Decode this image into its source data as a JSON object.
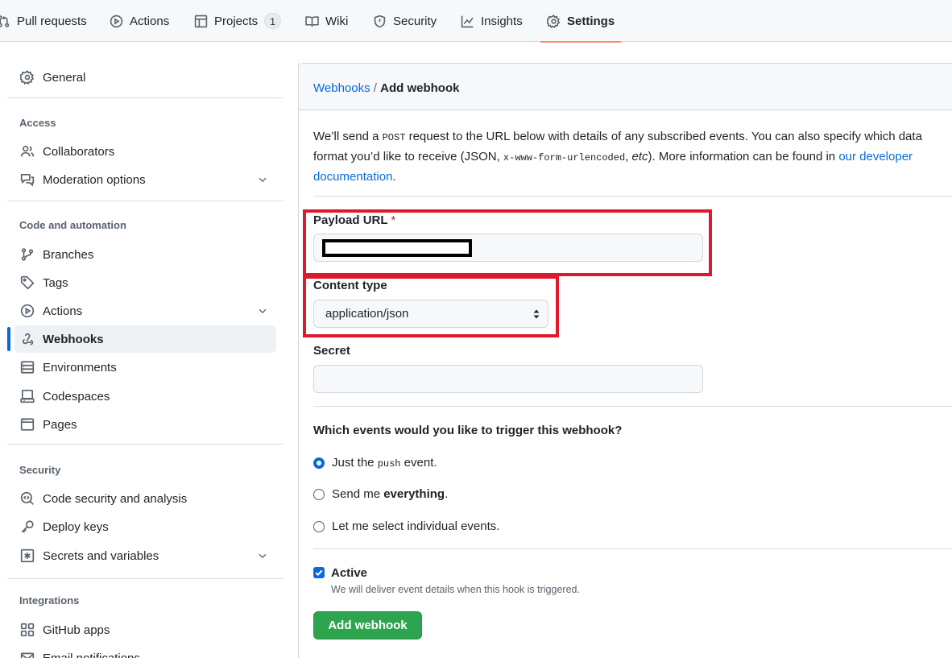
{
  "repo_nav": {
    "tabs": [
      {
        "label": "Pull requests",
        "icon": "pull-request-icon"
      },
      {
        "label": "Actions",
        "icon": "play-circle-icon"
      },
      {
        "label": "Projects",
        "icon": "table-icon",
        "count": "1"
      },
      {
        "label": "Wiki",
        "icon": "book-icon"
      },
      {
        "label": "Security",
        "icon": "shield-icon"
      },
      {
        "label": "Insights",
        "icon": "graph-icon"
      },
      {
        "label": "Settings",
        "icon": "gear-icon",
        "active": true
      }
    ]
  },
  "sidebar": {
    "general": "General",
    "access_heading": "Access",
    "collaborators": "Collaborators",
    "moderation": "Moderation options",
    "code_heading": "Code and automation",
    "branches": "Branches",
    "tags": "Tags",
    "actions": "Actions",
    "webhooks": "Webhooks",
    "environments": "Environments",
    "codespaces": "Codespaces",
    "pages": "Pages",
    "security_heading": "Security",
    "code_security": "Code security and analysis",
    "deploy_keys": "Deploy keys",
    "secrets": "Secrets and variables",
    "integrations_heading": "Integrations",
    "github_apps": "GitHub apps",
    "email_notifications": "Email notifications"
  },
  "main": {
    "breadcrumb_link": "Webhooks",
    "breadcrumb_sep": "/",
    "breadcrumb_current": "Add webhook",
    "intro_1": "We’ll send a ",
    "intro_post": "POST",
    "intro_2": " request to the URL below with details of any subscribed events. You can also specify which data format you’d like to receive (JSON, ",
    "intro_mono": "x-www-form-urlencoded",
    "intro_3": ", ",
    "intro_etc": "etc",
    "intro_4": "). More information can be found in ",
    "intro_link": "our developer documentation",
    "intro_5": ".",
    "payload_label": "Payload URL",
    "required_mark": "*",
    "content_type_label": "Content type",
    "content_type_value": "application/json",
    "secret_label": "Secret",
    "events_question": "Which events would you like to trigger this webhook?",
    "opt1_a": "Just the ",
    "opt1_code": "push",
    "opt1_b": " event.",
    "opt2_a": "Send me ",
    "opt2_b": "everything",
    "opt2_c": ".",
    "opt3": "Let me select individual events.",
    "selected_option": 0,
    "active_label": "Active",
    "active_checked": true,
    "active_note": "We will deliver event details when this hook is triggered.",
    "submit_label": "Add webhook"
  },
  "colors": {
    "accent": "#0969da",
    "primary_button": "#2da44e",
    "highlight_box": "#e0182b",
    "active_tab_underline": "#fd8c73"
  }
}
